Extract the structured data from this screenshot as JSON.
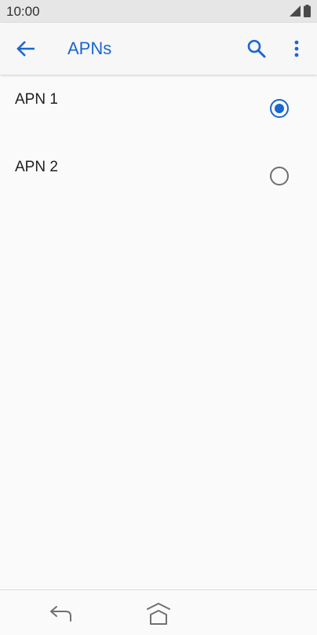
{
  "status_bar": {
    "time": "10:00",
    "icons": [
      "cell-signal-icon",
      "battery-icon"
    ]
  },
  "app_bar": {
    "title": "APNs",
    "accent_color": "#1a66d2",
    "icons": [
      "back-arrow-icon",
      "search-icon",
      "more-vert-icon"
    ]
  },
  "apn_list": {
    "items": [
      {
        "label": "APN 1",
        "selected": true
      },
      {
        "label": "APN 2",
        "selected": false
      }
    ]
  },
  "nav_bar": {
    "icons": [
      "nav-back-icon",
      "nav-home-icon"
    ]
  }
}
